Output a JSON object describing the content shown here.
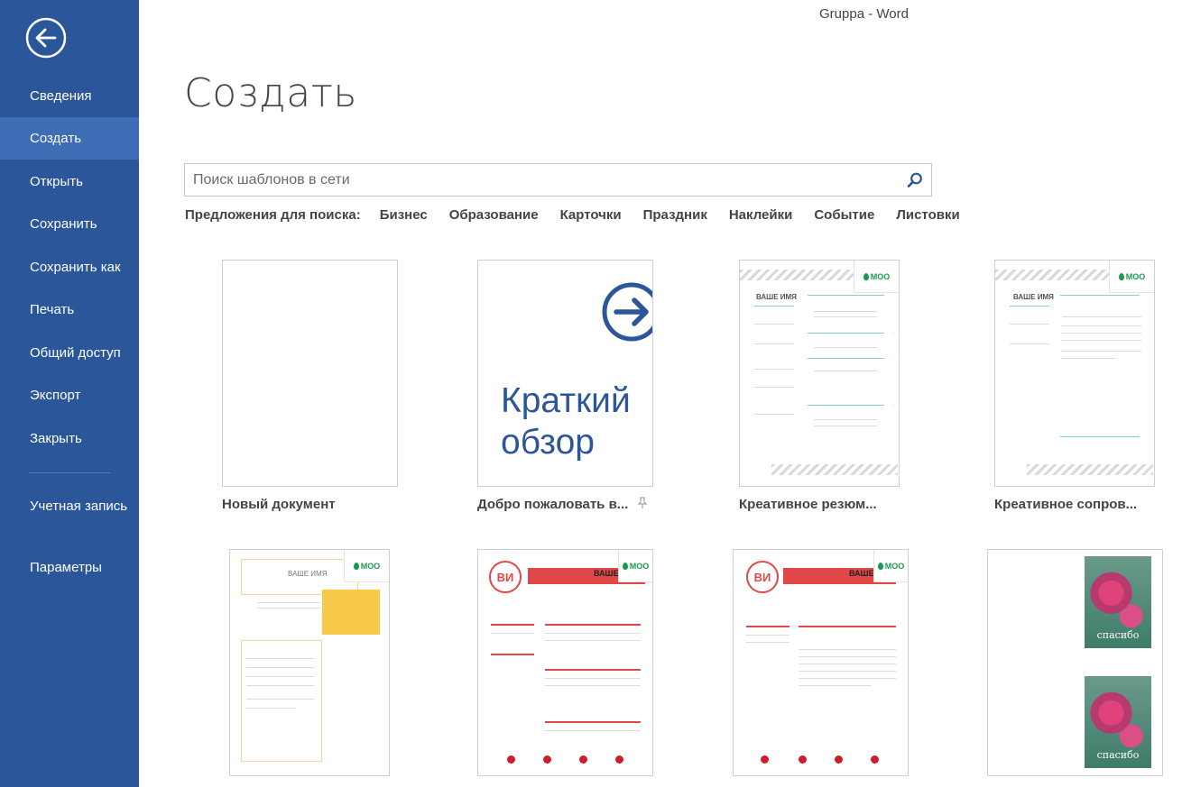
{
  "window": {
    "title": "Gruppa - Word"
  },
  "sidebar": {
    "back_icon": "back-arrow-icon",
    "items": [
      {
        "label": "Сведения"
      },
      {
        "label": "Создать",
        "active": true
      },
      {
        "label": "Открыть"
      },
      {
        "label": "Сохранить"
      },
      {
        "label": "Сохранить как"
      },
      {
        "label": "Печать"
      },
      {
        "label": "Общий доступ"
      },
      {
        "label": "Экспорт"
      },
      {
        "label": "Закрыть"
      }
    ],
    "account_label": "Учетная запись",
    "options_label": "Параметры"
  },
  "main": {
    "title": "Создать",
    "search": {
      "placeholder": "Поиск шаблонов в сети",
      "value": ""
    },
    "suggestions": {
      "label": "Предложения для поиска:",
      "items": [
        "Бизнес",
        "Образование",
        "Карточки",
        "Праздник",
        "Наклейки",
        "Событие",
        "Листовки"
      ]
    },
    "templates": [
      {
        "label": "Новый документ"
      },
      {
        "label": "Добро пожаловать в...",
        "thumb_text_1": "Краткий",
        "thumb_text_2": "обзор"
      },
      {
        "label": "Креативное резюм...",
        "thumb_name": "ВАШЕ ИМЯ"
      },
      {
        "label": "Креативное сопров...",
        "thumb_name": "ВАШЕ ИМЯ"
      },
      {
        "label": "",
        "thumb_name": "ВАШЕ ИМЯ"
      },
      {
        "label": "",
        "thumb_initials": "ВИ",
        "thumb_name": "ВАШЕ"
      },
      {
        "label": "",
        "thumb_initials": "ВИ",
        "thumb_name": "ВАШЕ"
      },
      {
        "label": "",
        "thumb_text": "спасибо"
      }
    ],
    "brand": "MOO"
  },
  "colors": {
    "sidebar": "#2b579a",
    "sidebar_active": "#3e6db5",
    "accent_blue": "#2b579a",
    "resume_red": "#e04848",
    "moo_green": "#1a9a4b"
  }
}
